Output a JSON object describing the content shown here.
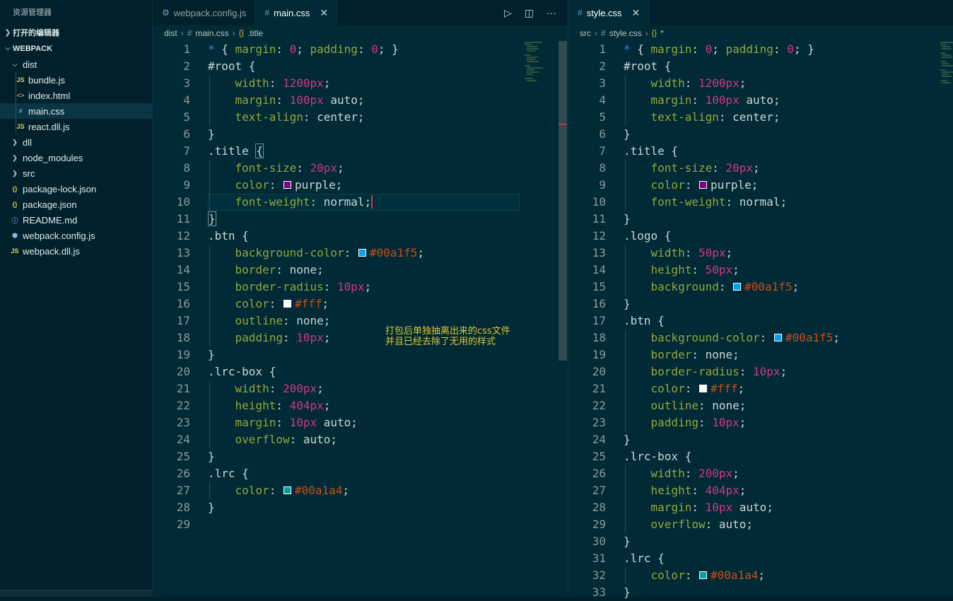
{
  "sidebar": {
    "title": "资源管理器",
    "open_editors_label": "打开的编辑器",
    "workspace_label": "WEBPACK",
    "items": [
      {
        "label": "dist",
        "icon": "chevron-down",
        "type": "folder",
        "indent": 1
      },
      {
        "label": "bundle.js",
        "icon": "JS",
        "type": "js",
        "indent": 2
      },
      {
        "label": "index.html",
        "icon": "<>",
        "type": "html",
        "indent": 2
      },
      {
        "label": "main.css",
        "icon": "#",
        "type": "css",
        "indent": 2,
        "selected": true
      },
      {
        "label": "react.dll.js",
        "icon": "JS",
        "type": "js",
        "indent": 2
      },
      {
        "label": "dll",
        "icon": "chevron-right",
        "type": "folder",
        "indent": 1
      },
      {
        "label": "node_modules",
        "icon": "chevron-right",
        "type": "folder",
        "indent": 1
      },
      {
        "label": "src",
        "icon": "chevron-right",
        "type": "folder",
        "indent": 1
      },
      {
        "label": "package-lock.json",
        "icon": "{}",
        "type": "json",
        "indent": 1
      },
      {
        "label": "package.json",
        "icon": "{}",
        "type": "json",
        "indent": 1
      },
      {
        "label": "README.md",
        "icon": "ⓘ",
        "type": "info",
        "indent": 1
      },
      {
        "label": "webpack.config.js",
        "icon": "⬢",
        "type": "cube",
        "indent": 1
      },
      {
        "label": "webpack.dll.js",
        "icon": "JS",
        "type": "js",
        "indent": 1
      }
    ]
  },
  "left_pane": {
    "tabs": [
      {
        "label": "webpack.config.js",
        "active": false
      },
      {
        "label": "main.css",
        "active": true
      }
    ],
    "breadcrumb": [
      "dist",
      "main.css",
      ".title"
    ],
    "note_lines": [
      "打包后单独抽离出来的css文件",
      "并且已经去除了无用的样式"
    ]
  },
  "right_pane": {
    "tabs": [
      {
        "label": "style.css",
        "active": true
      }
    ],
    "breadcrumb": [
      "src",
      "style.css",
      "*"
    ]
  },
  "colors": {
    "accent": "#00a1f5",
    "purple": "#800080",
    "white": "#ffffff",
    "teal": "#00a1a4",
    "cursor": "#dc322f"
  },
  "left_code": [
    [
      [
        "star",
        "* "
      ],
      [
        "punc",
        "{ "
      ],
      [
        "prop",
        "margin"
      ],
      [
        "punc",
        ": "
      ],
      [
        "num",
        "0"
      ],
      [
        "punc",
        "; "
      ],
      [
        "prop",
        "padding"
      ],
      [
        "punc",
        ": "
      ],
      [
        "num",
        "0"
      ],
      [
        "punc",
        "; }"
      ]
    ],
    [
      [
        "sel",
        "#root {"
      ]
    ],
    [
      [
        "ind",
        ""
      ],
      [
        "prop",
        "width"
      ],
      [
        "punc",
        ": "
      ],
      [
        "num",
        "1200px"
      ],
      [
        "punc",
        ";"
      ]
    ],
    [
      [
        "ind",
        ""
      ],
      [
        "prop",
        "margin"
      ],
      [
        "punc",
        ": "
      ],
      [
        "num",
        "100px"
      ],
      [
        "val",
        " auto;"
      ]
    ],
    [
      [
        "ind",
        ""
      ],
      [
        "prop",
        "text-align"
      ],
      [
        "punc",
        ": "
      ],
      [
        "val",
        "center;"
      ]
    ],
    [
      [
        "sel",
        "}"
      ]
    ],
    [
      [
        "sel",
        ".title "
      ],
      [
        "box",
        "{"
      ]
    ],
    [
      [
        "ind",
        ""
      ],
      [
        "prop",
        "font-size"
      ],
      [
        "punc",
        ": "
      ],
      [
        "num",
        "20px"
      ],
      [
        "punc",
        ";"
      ]
    ],
    [
      [
        "ind",
        ""
      ],
      [
        "prop",
        "color"
      ],
      [
        "punc",
        ": "
      ],
      [
        "sw",
        "#800080"
      ],
      [
        "val",
        "purple;"
      ]
    ],
    [
      [
        "ind",
        ""
      ],
      [
        "prop",
        "font-weight"
      ],
      [
        "punc",
        ": "
      ],
      [
        "val",
        "normal;"
      ],
      [
        "caret",
        ""
      ]
    ],
    [
      [
        "box",
        "}"
      ]
    ],
    [
      [
        "sel",
        ".btn {"
      ]
    ],
    [
      [
        "ind",
        ""
      ],
      [
        "prop",
        "background-color"
      ],
      [
        "punc",
        ": "
      ],
      [
        "sw",
        "#00a1f5"
      ],
      [
        "hex",
        "#00a1f5"
      ],
      [
        "punc",
        ";"
      ]
    ],
    [
      [
        "ind",
        ""
      ],
      [
        "prop",
        "border"
      ],
      [
        "punc",
        ": "
      ],
      [
        "val",
        "none;"
      ]
    ],
    [
      [
        "ind",
        ""
      ],
      [
        "prop",
        "border-radius"
      ],
      [
        "punc",
        ": "
      ],
      [
        "num",
        "10px"
      ],
      [
        "punc",
        ";"
      ]
    ],
    [
      [
        "ind",
        ""
      ],
      [
        "prop",
        "color"
      ],
      [
        "punc",
        ": "
      ],
      [
        "sw",
        "#ffffff"
      ],
      [
        "hex",
        "#fff"
      ],
      [
        "punc",
        ";"
      ]
    ],
    [
      [
        "ind",
        ""
      ],
      [
        "prop",
        "outline"
      ],
      [
        "punc",
        ": "
      ],
      [
        "val",
        "none;"
      ]
    ],
    [
      [
        "ind",
        ""
      ],
      [
        "prop",
        "padding"
      ],
      [
        "punc",
        ": "
      ],
      [
        "num",
        "10px"
      ],
      [
        "punc",
        ";"
      ]
    ],
    [
      [
        "sel",
        "}"
      ]
    ],
    [
      [
        "sel",
        ".lrc-box {"
      ]
    ],
    [
      [
        "ind",
        ""
      ],
      [
        "prop",
        "width"
      ],
      [
        "punc",
        ": "
      ],
      [
        "num",
        "200px"
      ],
      [
        "punc",
        ";"
      ]
    ],
    [
      [
        "ind",
        ""
      ],
      [
        "prop",
        "height"
      ],
      [
        "punc",
        ": "
      ],
      [
        "num",
        "404px"
      ],
      [
        "punc",
        ";"
      ]
    ],
    [
      [
        "ind",
        ""
      ],
      [
        "prop",
        "margin"
      ],
      [
        "punc",
        ": "
      ],
      [
        "num",
        "10px"
      ],
      [
        "val",
        " auto;"
      ]
    ],
    [
      [
        "ind",
        ""
      ],
      [
        "prop",
        "overflow"
      ],
      [
        "punc",
        ": "
      ],
      [
        "val",
        "auto;"
      ]
    ],
    [
      [
        "sel",
        "}"
      ]
    ],
    [
      [
        "sel",
        ".lrc {"
      ]
    ],
    [
      [
        "ind",
        ""
      ],
      [
        "prop",
        "color"
      ],
      [
        "punc",
        ": "
      ],
      [
        "sw",
        "#00a1a4"
      ],
      [
        "hex",
        "#00a1a4"
      ],
      [
        "punc",
        ";"
      ]
    ],
    [
      [
        "sel",
        "}"
      ]
    ],
    []
  ],
  "right_code": [
    [
      [
        "star",
        "* "
      ],
      [
        "punc",
        "{ "
      ],
      [
        "prop",
        "margin"
      ],
      [
        "punc",
        ": "
      ],
      [
        "num",
        "0"
      ],
      [
        "punc",
        "; "
      ],
      [
        "prop",
        "padding"
      ],
      [
        "punc",
        ": "
      ],
      [
        "num",
        "0"
      ],
      [
        "punc",
        "; }"
      ]
    ],
    [
      [
        "sel",
        "#root {"
      ]
    ],
    [
      [
        "ind",
        ""
      ],
      [
        "prop",
        "width"
      ],
      [
        "punc",
        ": "
      ],
      [
        "num",
        "1200px"
      ],
      [
        "punc",
        ";"
      ]
    ],
    [
      [
        "ind",
        ""
      ],
      [
        "prop",
        "margin"
      ],
      [
        "punc",
        ": "
      ],
      [
        "num",
        "100px"
      ],
      [
        "val",
        " auto;"
      ]
    ],
    [
      [
        "ind",
        ""
      ],
      [
        "prop",
        "text-align"
      ],
      [
        "punc",
        ": "
      ],
      [
        "val",
        "center;"
      ]
    ],
    [
      [
        "sel",
        "}"
      ]
    ],
    [
      [
        "sel",
        ".title {"
      ]
    ],
    [
      [
        "ind",
        ""
      ],
      [
        "prop",
        "font-size"
      ],
      [
        "punc",
        ": "
      ],
      [
        "num",
        "20px"
      ],
      [
        "punc",
        ";"
      ]
    ],
    [
      [
        "ind",
        ""
      ],
      [
        "prop",
        "color"
      ],
      [
        "punc",
        ": "
      ],
      [
        "sw",
        "#800080"
      ],
      [
        "val",
        "purple;"
      ]
    ],
    [
      [
        "ind",
        ""
      ],
      [
        "prop",
        "font-weight"
      ],
      [
        "punc",
        ": "
      ],
      [
        "val",
        "normal;"
      ]
    ],
    [
      [
        "sel",
        "}"
      ]
    ],
    [
      [
        "sel",
        ".logo {"
      ]
    ],
    [
      [
        "ind",
        ""
      ],
      [
        "prop",
        "width"
      ],
      [
        "punc",
        ": "
      ],
      [
        "num",
        "50px"
      ],
      [
        "punc",
        ";"
      ]
    ],
    [
      [
        "ind",
        ""
      ],
      [
        "prop",
        "height"
      ],
      [
        "punc",
        ": "
      ],
      [
        "num",
        "50px"
      ],
      [
        "punc",
        ";"
      ]
    ],
    [
      [
        "ind",
        ""
      ],
      [
        "prop",
        "background"
      ],
      [
        "punc",
        ": "
      ],
      [
        "sw",
        "#00a1f5"
      ],
      [
        "hex",
        "#00a1f5"
      ],
      [
        "punc",
        ";"
      ]
    ],
    [
      [
        "sel",
        "}"
      ]
    ],
    [
      [
        "sel",
        ".btn {"
      ]
    ],
    [
      [
        "ind",
        ""
      ],
      [
        "prop",
        "background-color"
      ],
      [
        "punc",
        ": "
      ],
      [
        "sw",
        "#00a1f5"
      ],
      [
        "hex",
        "#00a1f5"
      ],
      [
        "punc",
        ";"
      ]
    ],
    [
      [
        "ind",
        ""
      ],
      [
        "prop",
        "border"
      ],
      [
        "punc",
        ": "
      ],
      [
        "val",
        "none;"
      ]
    ],
    [
      [
        "ind",
        ""
      ],
      [
        "prop",
        "border-radius"
      ],
      [
        "punc",
        ": "
      ],
      [
        "num",
        "10px"
      ],
      [
        "punc",
        ";"
      ]
    ],
    [
      [
        "ind",
        ""
      ],
      [
        "prop",
        "color"
      ],
      [
        "punc",
        ": "
      ],
      [
        "sw",
        "#ffffff"
      ],
      [
        "hex",
        "#fff"
      ],
      [
        "punc",
        ";"
      ]
    ],
    [
      [
        "ind",
        ""
      ],
      [
        "prop",
        "outline"
      ],
      [
        "punc",
        ": "
      ],
      [
        "val",
        "none;"
      ]
    ],
    [
      [
        "ind",
        ""
      ],
      [
        "prop",
        "padding"
      ],
      [
        "punc",
        ": "
      ],
      [
        "num",
        "10px"
      ],
      [
        "punc",
        ";"
      ]
    ],
    [
      [
        "sel",
        "}"
      ]
    ],
    [
      [
        "sel",
        ".lrc-box {"
      ]
    ],
    [
      [
        "ind",
        ""
      ],
      [
        "prop",
        "width"
      ],
      [
        "punc",
        ": "
      ],
      [
        "num",
        "200px"
      ],
      [
        "punc",
        ";"
      ]
    ],
    [
      [
        "ind",
        ""
      ],
      [
        "prop",
        "height"
      ],
      [
        "punc",
        ": "
      ],
      [
        "num",
        "404px"
      ],
      [
        "punc",
        ";"
      ]
    ],
    [
      [
        "ind",
        ""
      ],
      [
        "prop",
        "margin"
      ],
      [
        "punc",
        ": "
      ],
      [
        "num",
        "10px"
      ],
      [
        "val",
        " auto;"
      ]
    ],
    [
      [
        "ind",
        ""
      ],
      [
        "prop",
        "overflow"
      ],
      [
        "punc",
        ": "
      ],
      [
        "val",
        "auto;"
      ]
    ],
    [
      [
        "sel",
        "}"
      ]
    ],
    [
      [
        "sel",
        ".lrc {"
      ]
    ],
    [
      [
        "ind",
        ""
      ],
      [
        "prop",
        "color"
      ],
      [
        "punc",
        ": "
      ],
      [
        "sw",
        "#00a1a4"
      ],
      [
        "hex",
        "#00a1a4"
      ],
      [
        "punc",
        ";"
      ]
    ],
    [
      [
        "sel",
        "}"
      ]
    ]
  ]
}
